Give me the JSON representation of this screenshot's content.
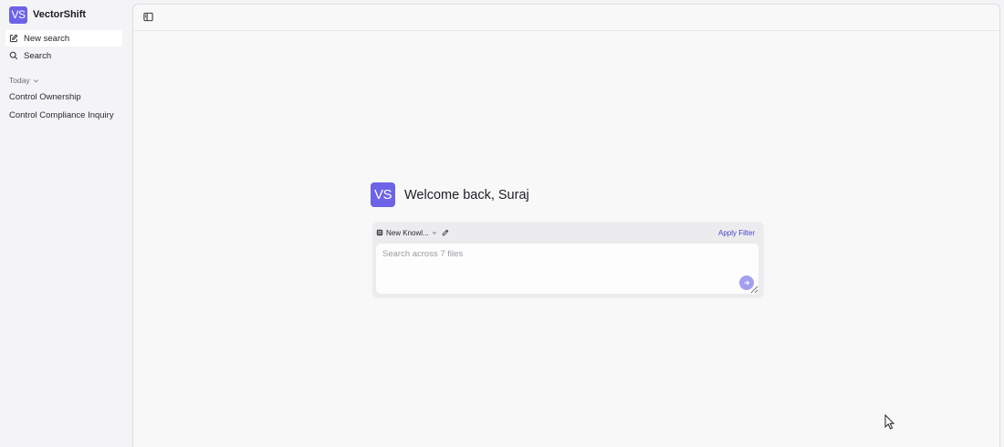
{
  "brand": {
    "name": "VectorShift",
    "logo_text": "VS"
  },
  "sidebar": {
    "nav": [
      {
        "label": "New search",
        "icon": "edit-icon",
        "active": true
      },
      {
        "label": "Search",
        "icon": "search-icon",
        "active": false
      }
    ],
    "section_label": "Today",
    "history": [
      "Control Ownership",
      "Control Compliance Inquiry"
    ]
  },
  "main": {
    "welcome": "Welcome back, Suraj",
    "knowledge_base": "New Knowl...",
    "apply_filter": "Apply Filter",
    "search_placeholder": "Search across 7 files"
  },
  "colors": {
    "accent": "#6c63e6",
    "submit_button": "#a39ff0",
    "link": "#4b44c8"
  }
}
